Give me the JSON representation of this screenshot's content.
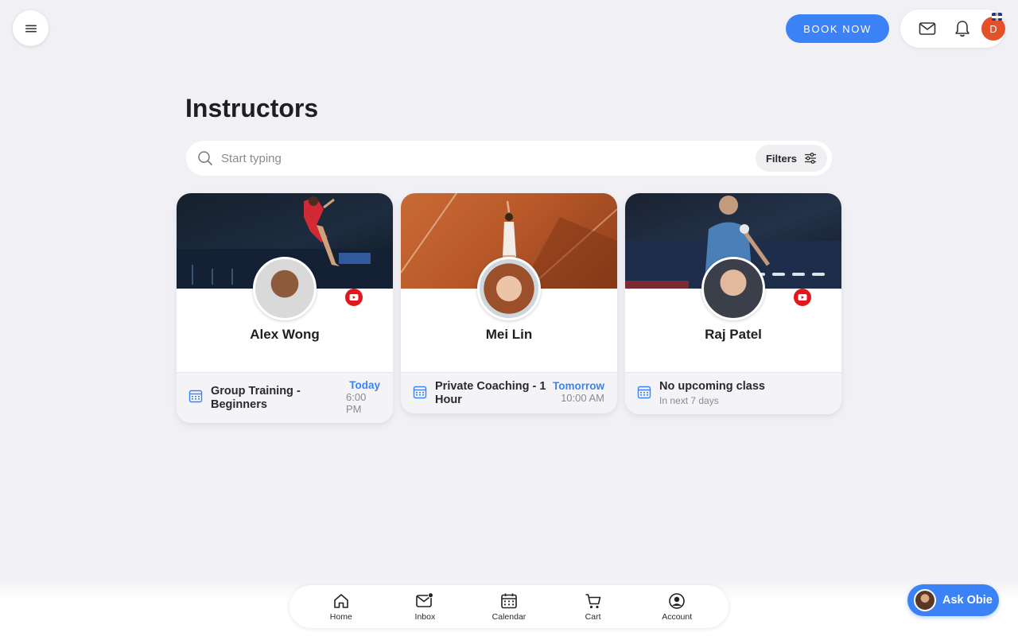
{
  "header": {
    "book_label": "BOOK NOW",
    "avatar_initial": "D",
    "accent": "#3b82f6",
    "avatar_color": "#e4502a"
  },
  "main": {
    "title": "Instructors",
    "search_placeholder": "Start typing",
    "filters_label": "Filters"
  },
  "instructors": [
    {
      "name": "Alex Wong",
      "class_title": "Group Training - Beginners",
      "day": "Today",
      "time": "6:00 PM",
      "has_youtube": true
    },
    {
      "name": "Mei Lin",
      "class_title": "Private Coaching - 1 Hour",
      "day": "Tomorrow",
      "time": "10:00 AM",
      "has_youtube": false
    },
    {
      "name": "Raj Patel",
      "class_title": "No upcoming class",
      "subtitle": "In next 7 days",
      "has_youtube": true
    }
  ],
  "bottom_nav": {
    "items": [
      {
        "label": "Home",
        "icon": "home-icon"
      },
      {
        "label": "Inbox",
        "icon": "inbox-icon"
      },
      {
        "label": "Calendar",
        "icon": "calendar-icon"
      },
      {
        "label": "Cart",
        "icon": "cart-icon"
      },
      {
        "label": "Account",
        "icon": "account-icon"
      }
    ]
  },
  "assistant": {
    "label": "Ask Obie"
  }
}
